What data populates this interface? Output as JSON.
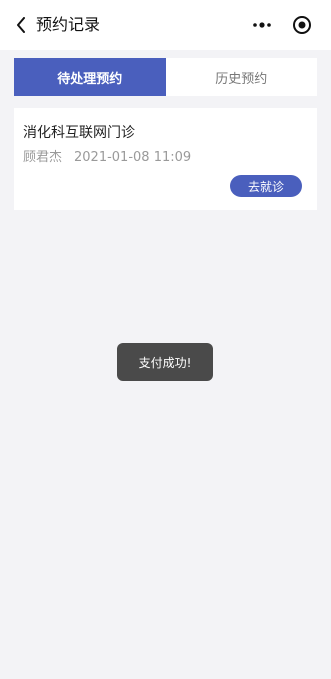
{
  "nav": {
    "title": "预约记录",
    "back_icon": "chevron-left-icon",
    "more_icon": "more-dots-icon",
    "target_icon": "target-circle-icon"
  },
  "tabs": [
    {
      "label": "待处理预约",
      "active": true
    },
    {
      "label": "历史预约",
      "active": false
    }
  ],
  "appointment": {
    "clinic": "消化科互联网门诊",
    "doctor": "顾君杰",
    "datetime": "2021-01-08 11:09",
    "action_label": "去就诊"
  },
  "toast": {
    "message": "支付成功!"
  },
  "colors": {
    "accent": "#4a5fbd",
    "background": "#f3f3f6"
  }
}
